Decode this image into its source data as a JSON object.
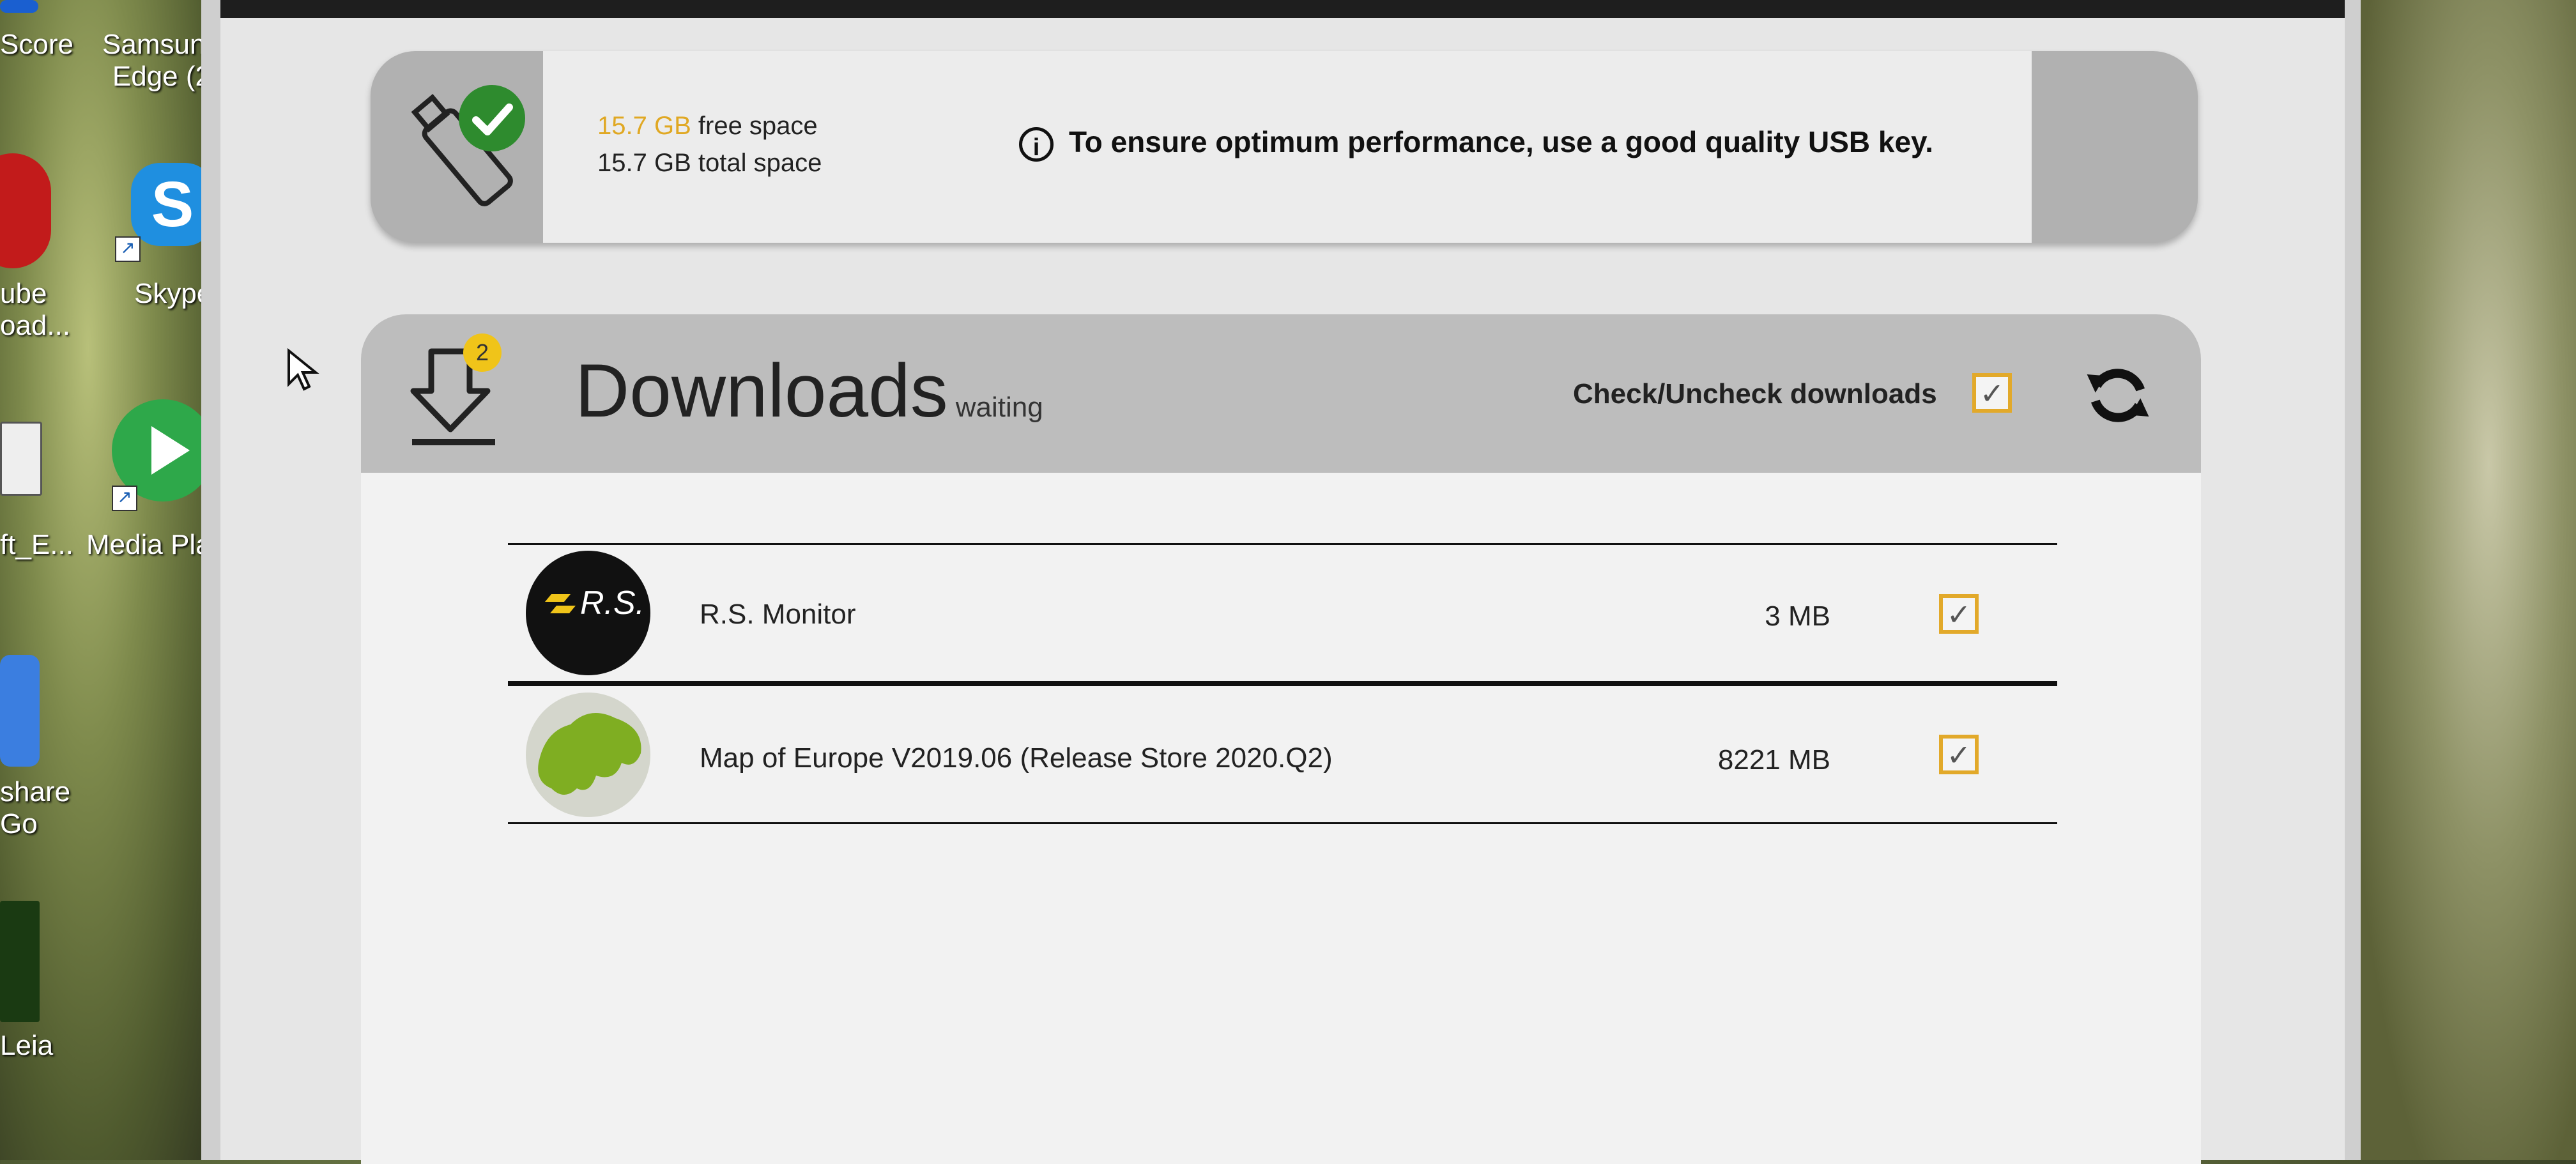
{
  "desktop": {
    "icons": [
      {
        "label": "Score",
        "name": "desktop-score"
      },
      {
        "label": "Samsung Edge (2",
        "name": "desktop-samsung-edge"
      },
      {
        "label": "ube oad...",
        "name": "desktop-youtube-download"
      },
      {
        "label": "Skype",
        "name": "desktop-skype"
      },
      {
        "label": "ft_E...",
        "name": "desktop-ft-e"
      },
      {
        "label": "Media Pla",
        "name": "desktop-media-player"
      },
      {
        "label": "share Go",
        "name": "desktop-share-go"
      },
      {
        "label": "Leia",
        "name": "desktop-leia"
      }
    ]
  },
  "storage": {
    "free_value": "15.7 GB",
    "free_label": "free space",
    "total_text": "15.7 GB total space",
    "note": "To ensure optimum performance, use a good quality USB key."
  },
  "downloads": {
    "title": "Downloads",
    "status": "waiting",
    "badge_count": "2",
    "check_all_label": "Check/Uncheck downloads",
    "check_mark": "✓",
    "items": [
      {
        "logo_text": "R.S.",
        "name": "R.S. Monitor",
        "size": "3 MB",
        "checked": true
      },
      {
        "name": "Map of Europe V2019.06 (Release Store 2020.Q2)",
        "size": "8221 MB",
        "checked": true
      }
    ]
  },
  "colors": {
    "accent": "#e2a92a",
    "badge": "#f0c419",
    "check_green": "#2e8b2e"
  }
}
